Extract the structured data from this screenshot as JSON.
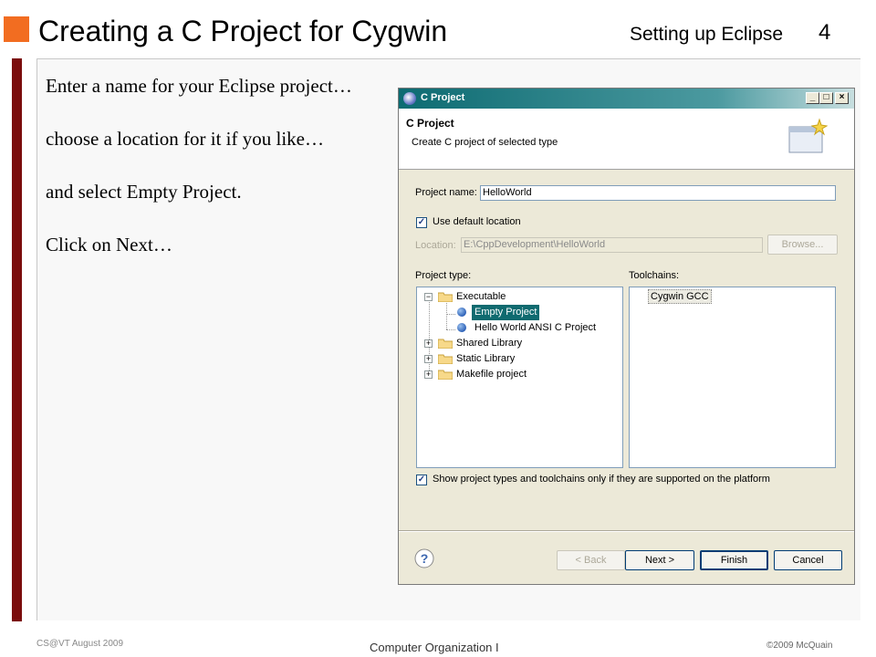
{
  "slide": {
    "title": "Creating a C Project for Cygwin",
    "section": "Setting up Eclipse",
    "page_number": "4",
    "instructions": [
      "Enter a name for your Eclipse project…",
      "choose a location for it if you like…",
      "and select Empty Project.",
      "Click on Next…"
    ],
    "footer_left": "CS@VT August 2009",
    "footer_center": "Computer Organization I",
    "footer_right": "©2009  McQuain",
    "colors": {
      "accent_square": "#f26d21",
      "side_bar": "#7b0d0d"
    }
  },
  "dialog": {
    "window_title": "C Project",
    "window_buttons": [
      "minimize",
      "maximize",
      "close"
    ],
    "header_title": "C Project",
    "header_description": "Create C project of selected type",
    "project_name_label": "Project name:",
    "project_name_value": "HelloWorld",
    "use_default_location_label": "Use default location",
    "use_default_location_checked": true,
    "location_label": "Location:",
    "location_value": "E:\\CppDevelopment\\HelloWorld",
    "browse_label": "Browse...",
    "project_type_label": "Project type:",
    "toolchains_label": "Toolchains:",
    "project_types": [
      {
        "label": "Executable",
        "expander": "⊟",
        "icon": "folder-icon"
      },
      {
        "label": "Empty Project",
        "icon": "bullet-icon",
        "selected": true
      },
      {
        "label": "Hello World ANSI C Project",
        "icon": "bullet-icon"
      },
      {
        "label": "Shared Library",
        "expander": "⊞",
        "icon": "folder-icon"
      },
      {
        "label": "Static Library",
        "expander": "⊞",
        "icon": "folder-icon"
      },
      {
        "label": "Makefile project",
        "expander": "⊞",
        "icon": "folder-icon"
      }
    ],
    "toolchains": [
      "Cygwin GCC"
    ],
    "show_supported_label": "Show project types and toolchains only if they are supported on the platform",
    "show_supported_checked": true,
    "help_icon": "help-icon",
    "buttons": {
      "back": "< Back",
      "next": "Next >",
      "finish": "Finish",
      "cancel": "Cancel"
    },
    "colors": {
      "titlebar": "#0d6b72",
      "selection": "#0f6a6f"
    }
  }
}
